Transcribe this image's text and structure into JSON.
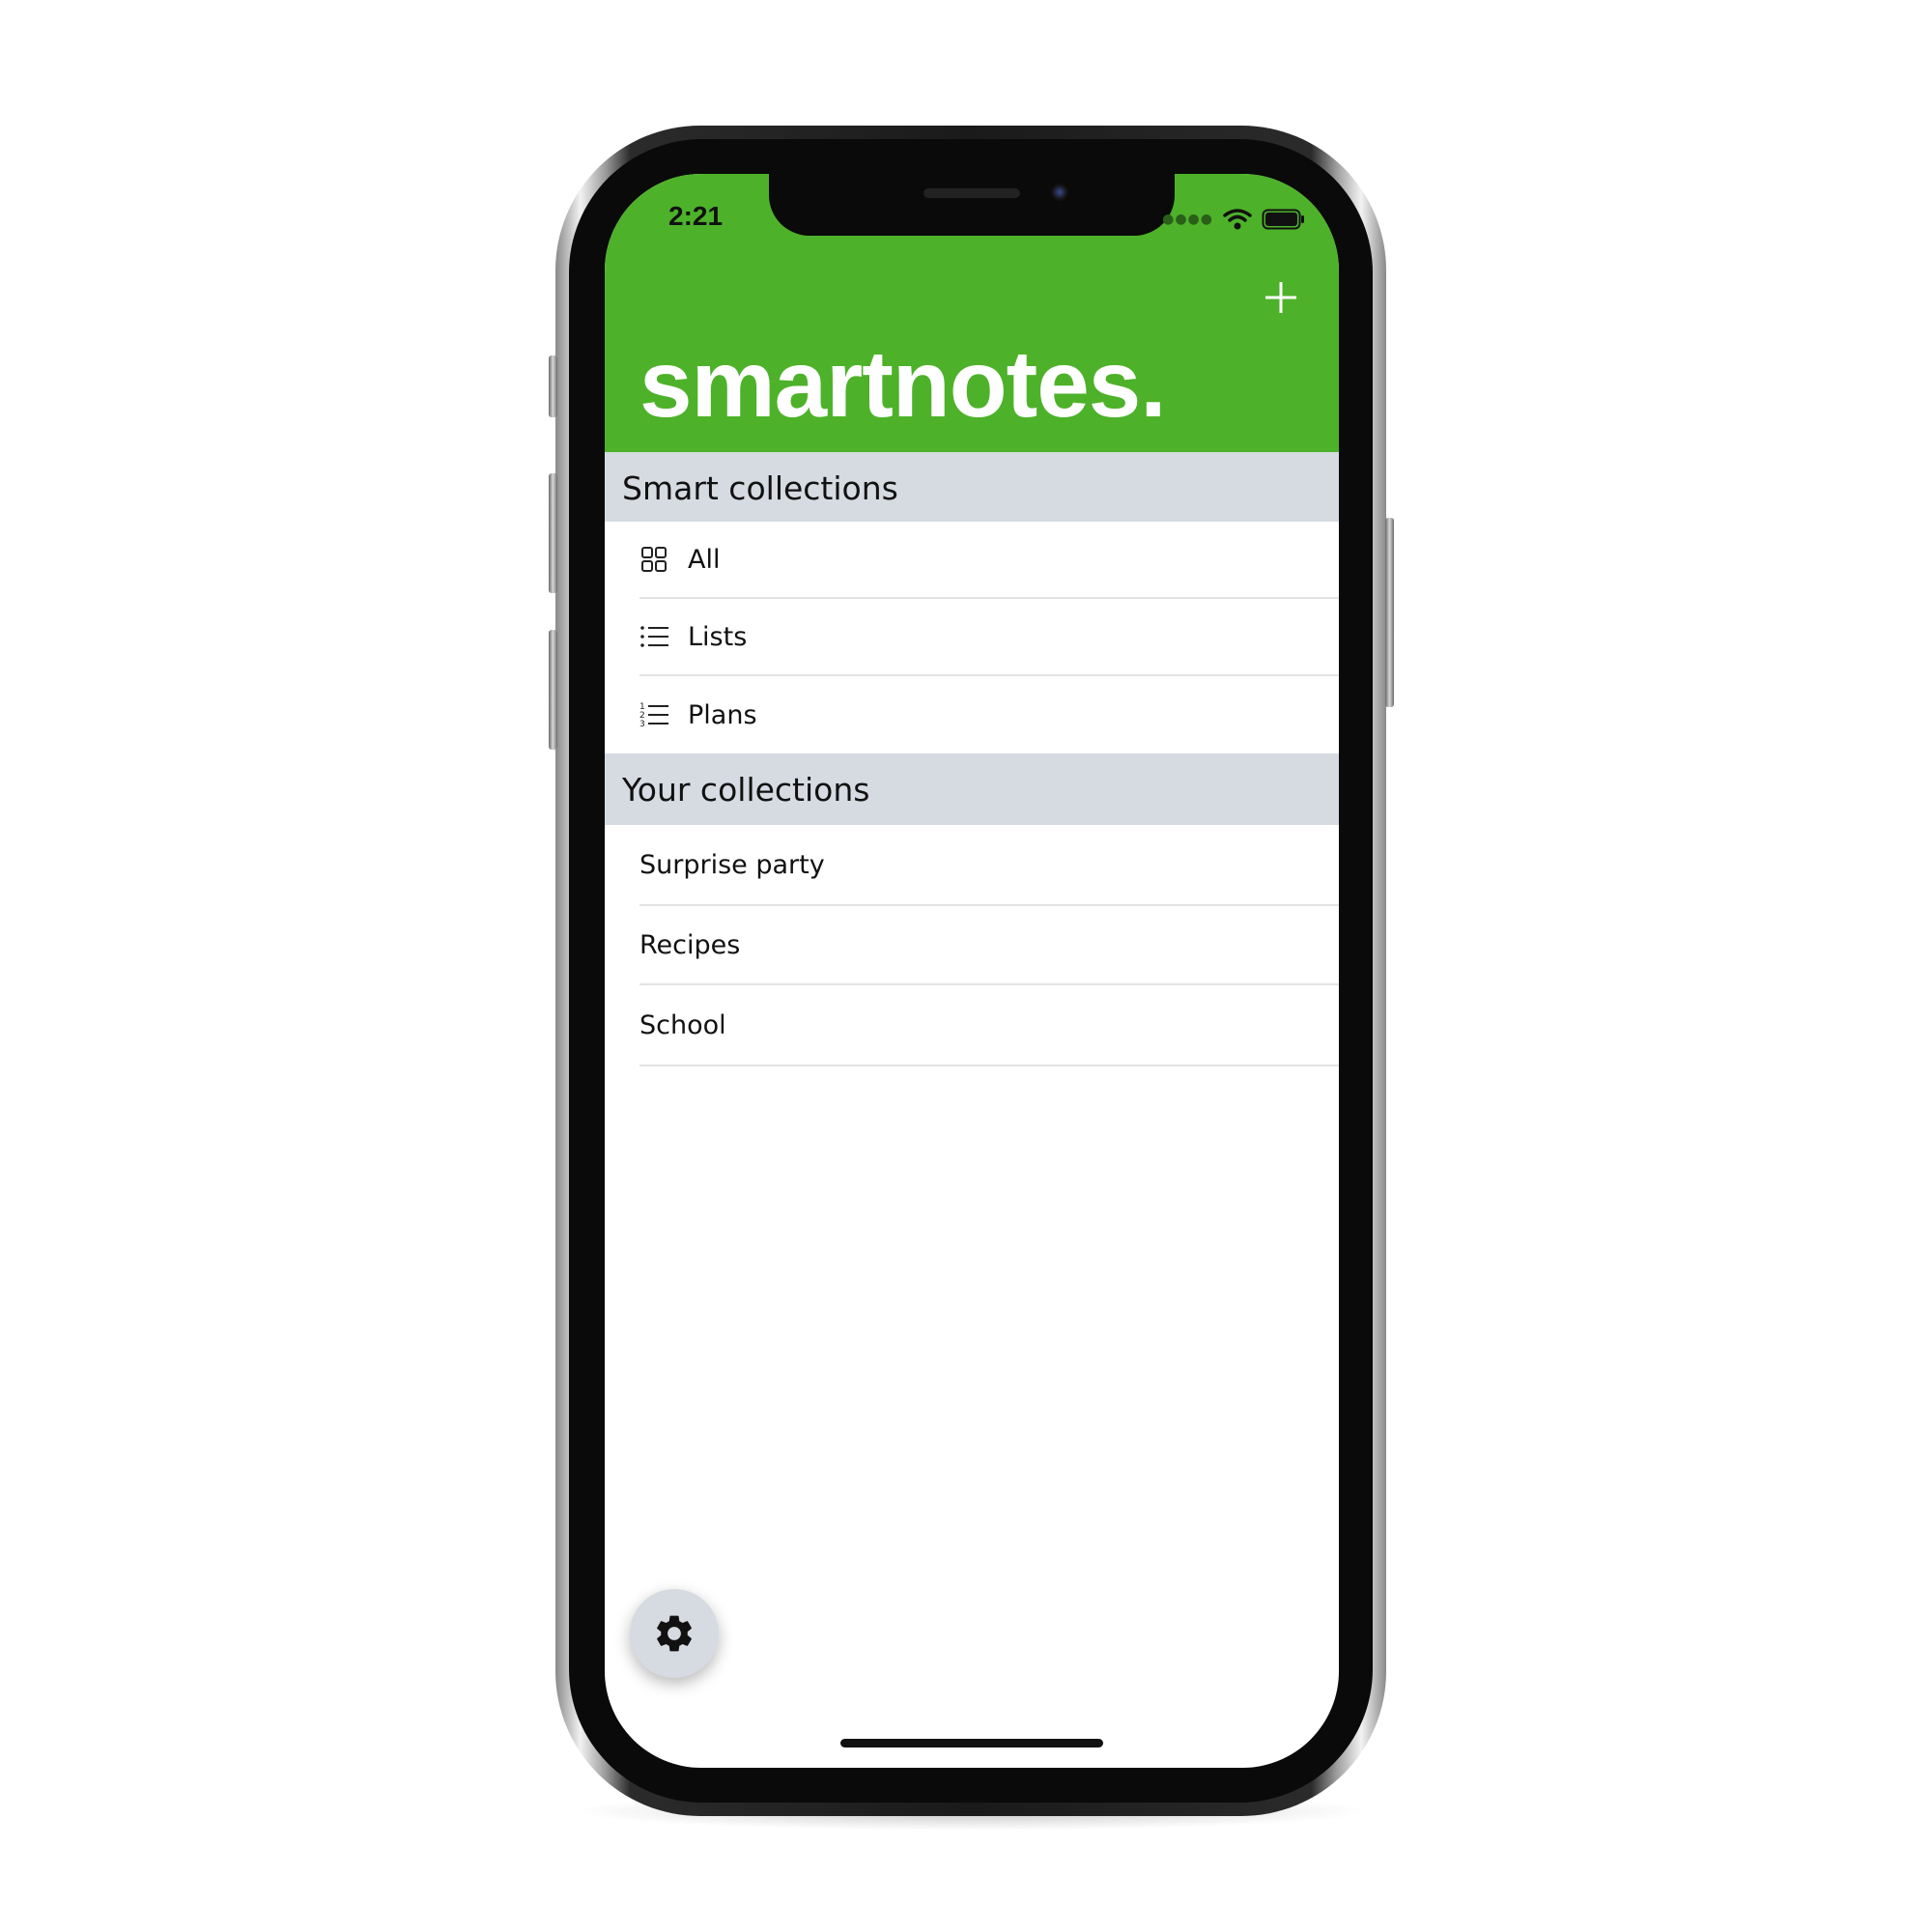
{
  "status_bar": {
    "time": "2:21",
    "signal_icon": "signal-dots-icon",
    "wifi_icon": "wifi-icon",
    "battery_icon": "battery-icon"
  },
  "header": {
    "title": "smartnotes.",
    "add_icon": "plus-icon",
    "background_color": "#4db229"
  },
  "smart_collections": {
    "heading": "Smart collections",
    "items": [
      {
        "label": "All",
        "icon": "grid-icon"
      },
      {
        "label": "Lists",
        "icon": "list-icon"
      },
      {
        "label": "Plans",
        "icon": "numbered-list-icon"
      }
    ]
  },
  "your_collections": {
    "heading": "Your collections",
    "items": [
      {
        "label": "Surprise party"
      },
      {
        "label": "Recipes"
      },
      {
        "label": "School"
      }
    ]
  },
  "settings_button": {
    "icon": "gear-icon",
    "background_color": "#d6dbe1"
  },
  "section_header_color": "#d6dbe1"
}
